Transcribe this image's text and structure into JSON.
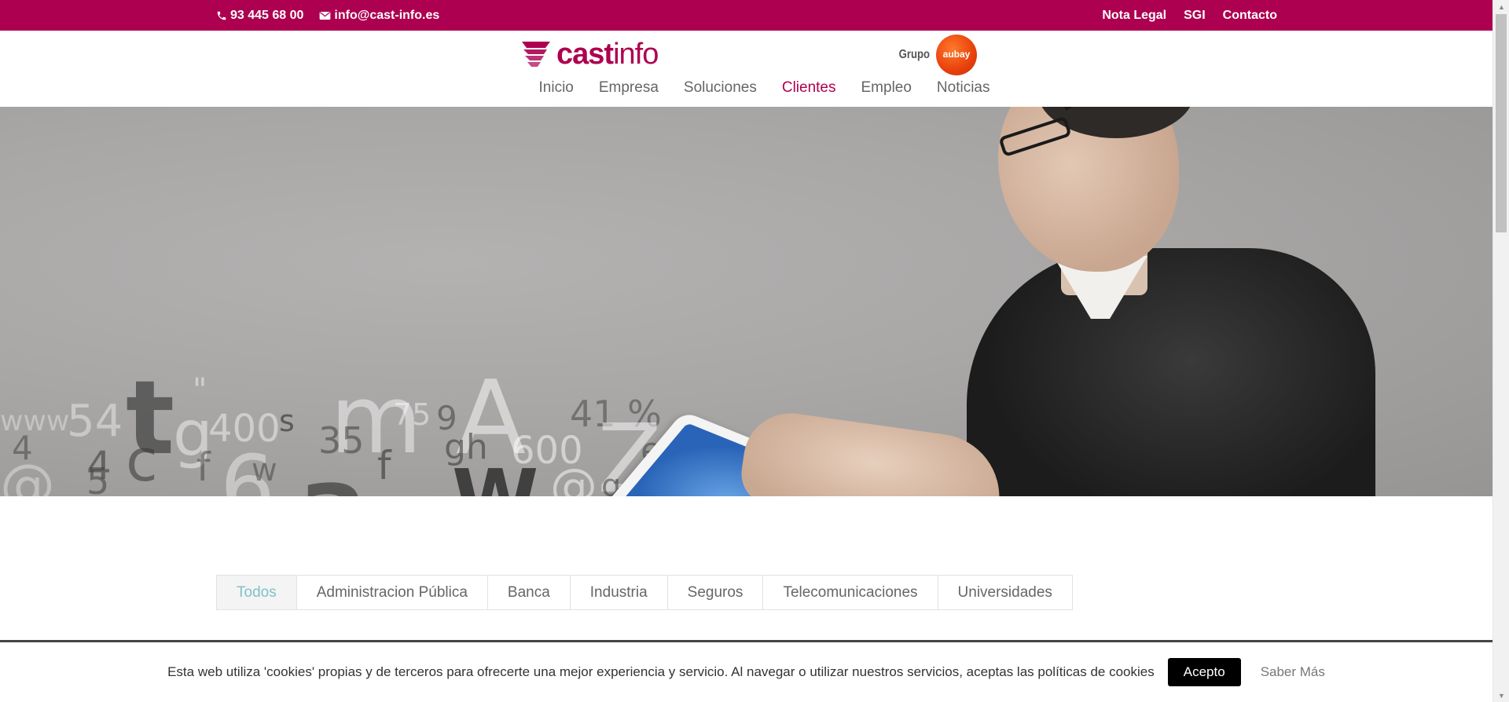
{
  "topbar": {
    "phone": "93 445 68 00",
    "email": "info@cast-info.es",
    "links": [
      "Nota Legal",
      "SGI",
      "Contacto"
    ],
    "background": "#ad0050"
  },
  "header": {
    "logo_bold": "cast",
    "logo_light": "info",
    "grupo_label": "Grupo",
    "grupo_badge": "aubay",
    "nav": [
      {
        "label": "Inicio",
        "active": false
      },
      {
        "label": "Empresa",
        "active": false
      },
      {
        "label": "Soluciones",
        "active": false
      },
      {
        "label": "Clientes",
        "active": true
      },
      {
        "label": "Empleo",
        "active": false
      },
      {
        "label": "Noticias",
        "active": false
      }
    ],
    "accent": "#ad0050"
  },
  "filters": {
    "items": [
      "Todos",
      "Administracion Pública",
      "Banca",
      "Industria",
      "Seguros",
      "Telecomunicaciones",
      "Universidades"
    ],
    "active": "Todos",
    "active_color": "#82c0c7"
  },
  "cookie": {
    "text": "Esta web utiliza 'cookies' propias y de terceros para ofrecerte una mejor experiencia y servicio. Al navegar o utilizar nuestros servicios, aceptas las políticas de cookies",
    "accept_label": "Acepto",
    "more_label": "Saber Más"
  },
  "icons": {
    "phone": "phone-icon",
    "email": "envelope-icon"
  }
}
